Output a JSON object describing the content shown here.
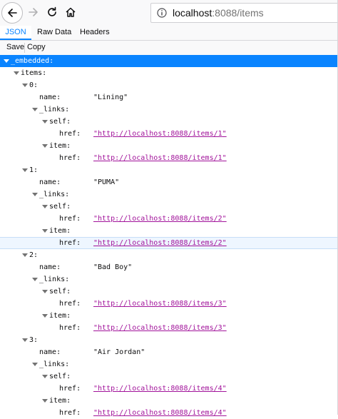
{
  "toolbar": {
    "back_icon": "arrow-left-icon",
    "forward_icon": "arrow-right-icon",
    "reload_icon": "reload-icon",
    "home_icon": "home-icon",
    "url_host": "localhost",
    "url_rest": ":8088/items"
  },
  "tabs": [
    "JSON",
    "Raw Data",
    "Headers"
  ],
  "actions": {
    "save": "Save",
    "copy": "Copy"
  },
  "tree": {
    "embedded_key": "_embedded:",
    "items_key": "items:",
    "name_key": "name:",
    "links_key": "_links:",
    "self_key": "self:",
    "item_key": "item:",
    "href_key": "href:",
    "items": [
      {
        "index": "0:",
        "name": "\"Lining\"",
        "self_href": "http://localhost:8088/items/1",
        "item_href": "http://localhost:8088/items/1"
      },
      {
        "index": "1:",
        "name": "\"PUMA\"",
        "self_href": "http://localhost:8088/items/2",
        "item_href": "http://localhost:8088/items/2"
      },
      {
        "index": "2:",
        "name": "\"Bad Boy\"",
        "self_href": "http://localhost:8088/items/3",
        "item_href": "http://localhost:8088/items/3"
      },
      {
        "index": "3:",
        "name": "\"Air Jordan\"",
        "self_href": "http://localhost:8088/items/4",
        "item_href": "http://localhost:8088/items/4"
      }
    ]
  }
}
